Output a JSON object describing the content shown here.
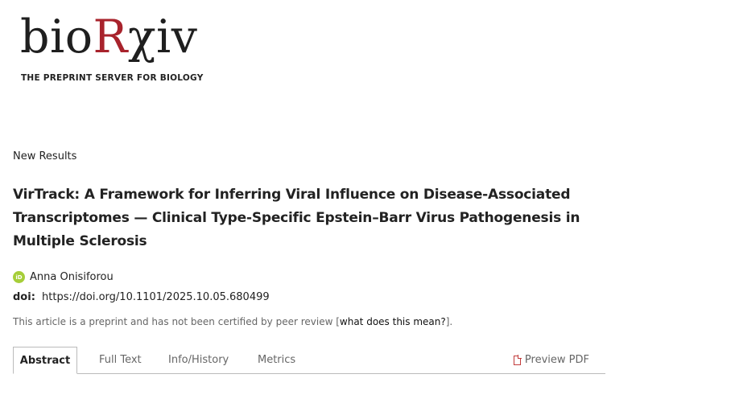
{
  "logo": {
    "parts": [
      "bio",
      "R",
      "χiv"
    ],
    "tagline": "THE PREPRINT SERVER FOR BIOLOGY"
  },
  "article": {
    "section": "New Results",
    "title": "VirTrack: A Framework for Inferring Viral Influence on Disease-Associated Transcriptomes — Clinical Type-Specific Epstein–Barr Virus Pathogenesis in Multiple Sclerosis",
    "author": "Anna Onisiforou",
    "orcid_icon": "iD",
    "doi_label": "doi:",
    "doi_url": "https://doi.org/10.1101/2025.10.05.680499",
    "notice_prefix": "This article is a preprint and has not been certified by peer review [",
    "notice_link": "what does this mean?",
    "notice_suffix": "]."
  },
  "tabs": {
    "abstract": "Abstract",
    "full_text": "Full Text",
    "info_history": "Info/History",
    "metrics": "Metrics",
    "preview_pdf": "Preview PDF"
  },
  "colors": {
    "brand_red": "#a8232c",
    "orcid_green": "#a6ce39",
    "pdf_red": "#c23b3b"
  }
}
